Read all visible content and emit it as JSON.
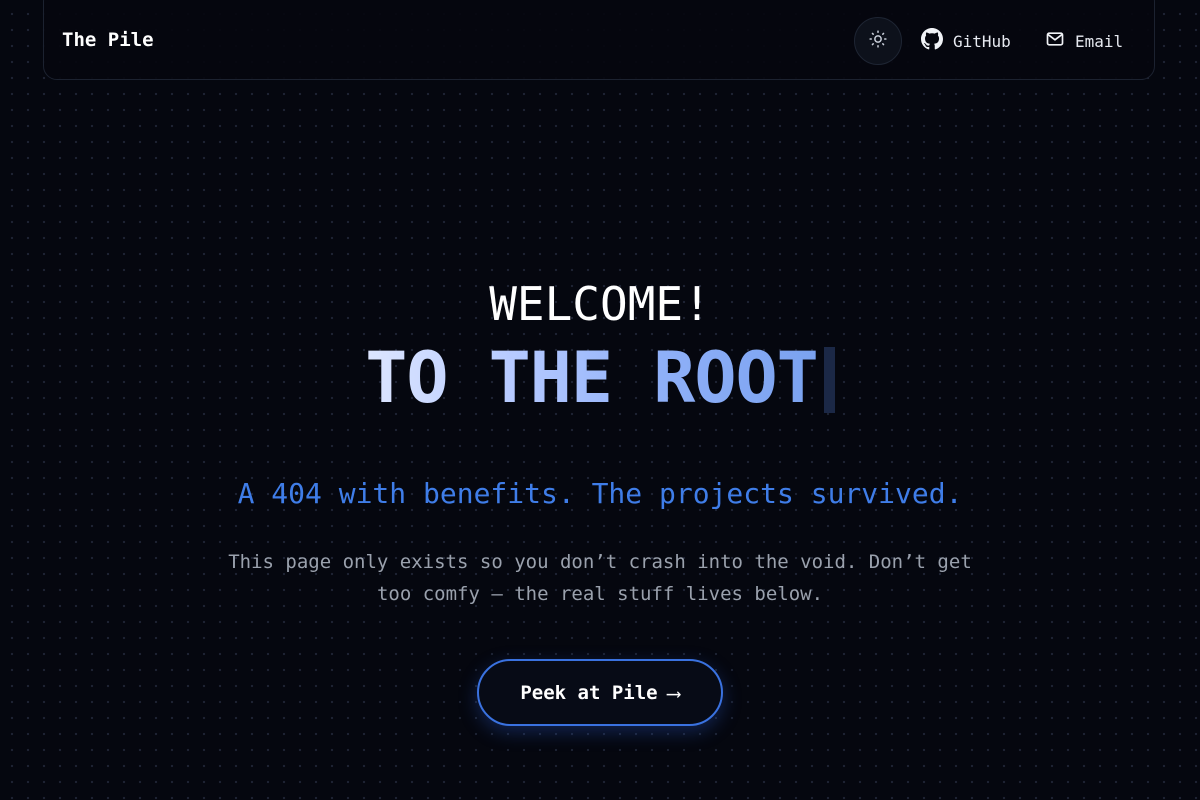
{
  "header": {
    "brand": "The Pile",
    "github_label": "GitHub",
    "email_label": "Email"
  },
  "hero": {
    "welcome": "WELCOME!",
    "headline": "TO THE ROOT",
    "tagline": "A 404 with benefits. The projects survived.",
    "description": "This page only exists so you don’t crash into the void. Don’t get too comfy — the real stuff lives below.",
    "cta_label": "Peek at Pile",
    "cta_arrow": "⟶"
  },
  "icons": {
    "theme_toggle": "sun-icon",
    "github": "github-icon",
    "email": "mail-icon",
    "cta": "arrow-right-icon"
  },
  "colors": {
    "background": "#05070f",
    "accent": "#3f7de8",
    "headline_gradient_start": "#dde6ff",
    "headline_gradient_end": "#7aa2f0",
    "cursor": "#1b2846",
    "muted_text": "#9aa1ad"
  }
}
